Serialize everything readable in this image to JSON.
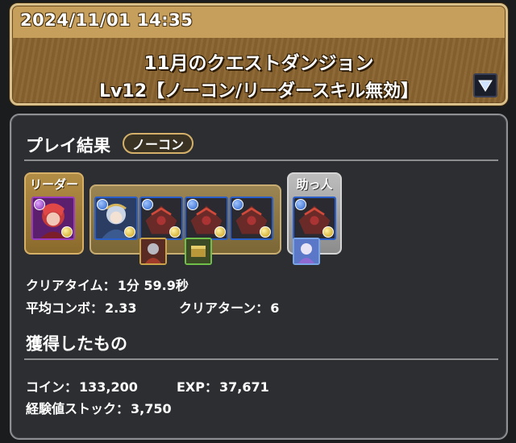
{
  "header": {
    "datetime": "2024/11/01 14:35",
    "dungeon_title": "11月のクエストダンジョン",
    "floor_title": "Lv12【ノーコン/リーダースキル無効】",
    "dropdown_icon": "triangle-down-icon"
  },
  "result": {
    "title": "プレイ結果",
    "badge": "ノーコン",
    "team": {
      "leader_label": "リーダー",
      "helper_label": "助っ人"
    },
    "clear_time_label": "クリアタイム：",
    "clear_time_value": "1分 59.9秒",
    "avg_combo_label": "平均コンボ：",
    "avg_combo_value": "2.33",
    "clear_turn_label": "クリアターン：",
    "clear_turn_value": "6"
  },
  "acquired": {
    "title": "獲得したもの",
    "coin_label": "コイン：",
    "coin_value": "133,200",
    "exp_label": "EXP：",
    "exp_value": "37,671",
    "stock_label": "経験値ストック：",
    "stock_value": "3,750"
  },
  "colors": {
    "header_gold": "#c79f5d",
    "panel_bg": "#2c2e31",
    "badge_border": "#d4b06a"
  }
}
